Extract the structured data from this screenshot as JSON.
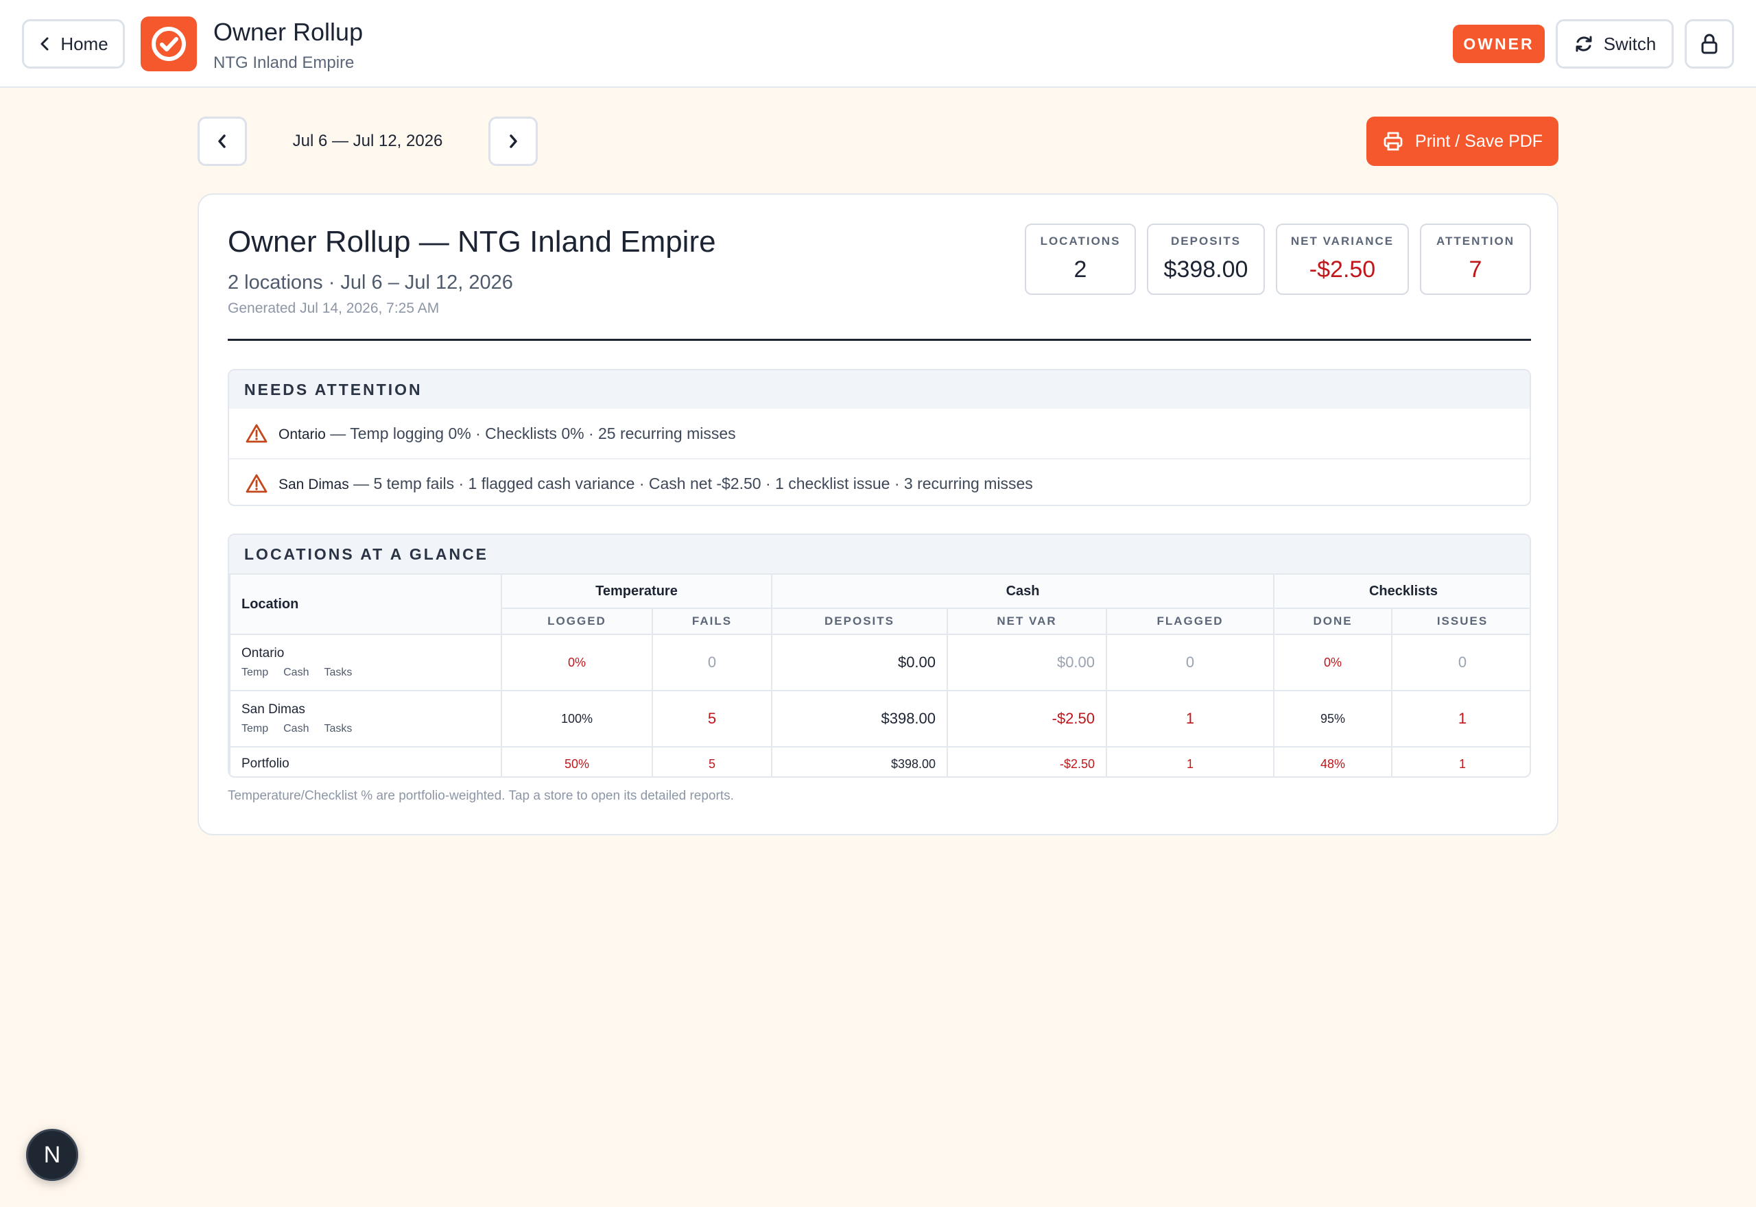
{
  "header": {
    "home_label": "Home",
    "title": "Owner Rollup",
    "subtitle": "NTG Inland Empire",
    "role_badge": "OWNER",
    "switch_label": "Switch"
  },
  "week": {
    "range_label": "Jul 6 — Jul 12, 2026",
    "print_label": "Print / Save PDF"
  },
  "report": {
    "title": "Owner Rollup — NTG Inland Empire",
    "meta": "2 locations · Jul 6 – Jul 12, 2026",
    "generated": "Generated Jul 14, 2026, 7:25 AM",
    "stats": [
      {
        "label": "LOCATIONS",
        "value": "2"
      },
      {
        "label": "DEPOSITS",
        "value": "$398.00"
      },
      {
        "label": "NET VARIANCE",
        "value": "-$2.50"
      },
      {
        "label": "ATTENTION",
        "value": "7"
      }
    ]
  },
  "attention": {
    "heading": "NEEDS ATTENTION",
    "items": [
      {
        "location": "Ontario",
        "detail": "— Temp logging 0% · Checklists 0% · 25 recurring misses"
      },
      {
        "location": "San Dimas",
        "detail": "— 5 temp fails · 1 flagged cash variance · Cash net -$2.50 · 1 checklist issue · 3 recurring misses"
      }
    ]
  },
  "glance": {
    "heading": "LOCATIONS AT A GLANCE",
    "location_header": "Location",
    "groups": {
      "temperature": "Temperature",
      "cash": "Cash",
      "checklists": "Checklists"
    },
    "columns": {
      "logged": "LOGGED",
      "fails": "FAILS",
      "deposits": "DEPOSITS",
      "net_var": "NET VAR",
      "flagged": "FLAGGED",
      "done": "DONE",
      "issues": "ISSUES"
    },
    "links": {
      "temp": "Temp",
      "cash": "Cash",
      "tasks": "Tasks"
    },
    "rows": [
      {
        "name": "Ontario",
        "logged": "0%",
        "fails": "0",
        "deposits": "$0.00",
        "net_var": "$0.00",
        "flagged": "0",
        "done": "0%",
        "issues": "0"
      },
      {
        "name": "San Dimas",
        "logged": "100%",
        "fails": "5",
        "deposits": "$398.00",
        "net_var": "-$2.50",
        "flagged": "1",
        "done": "95%",
        "issues": "1"
      }
    ],
    "portfolio": {
      "name": "Portfolio",
      "logged": "50%",
      "fails": "5",
      "deposits": "$398.00",
      "net_var": "-$2.50",
      "flagged": "1",
      "done": "48%",
      "issues": "1"
    },
    "footnote": "Temperature/Checklist % are portfolio-weighted. Tap a store to open its detailed reports."
  },
  "dev_badge": "N",
  "colors": {
    "accent": "#f4582c",
    "negative": "#c0161a",
    "warning": "#c4471c",
    "background": "#fff8ef"
  }
}
